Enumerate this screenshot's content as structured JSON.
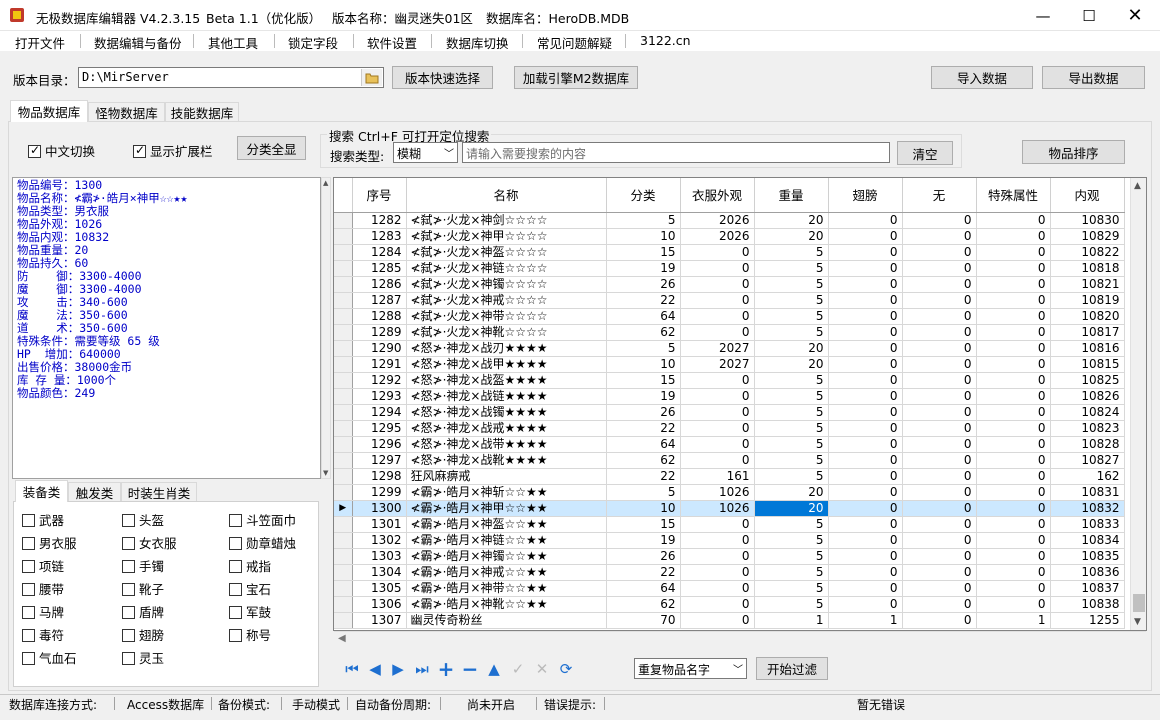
{
  "title": {
    "app": "无极数据库编辑器 V4.2.3.15",
    "beta": "Beta 1.1（优化版）",
    "version_name": "版本名称：幽灵迷失01区",
    "db_name": "数据库名：HeroDB.MDB"
  },
  "menu": [
    "打开文件",
    "数据编辑与备份",
    "其他工具",
    "锁定字段",
    "软件设置",
    "数据库切换",
    "常见问题解疑",
    "3122.cn"
  ],
  "toolbar": {
    "dir_label": "版本目录：",
    "dir_value": "D:\\MirServer",
    "quick_select": "版本快速选择",
    "load_engine": "加载引擎M2数据库",
    "import": "导入数据",
    "export": "导出数据"
  },
  "tabs": [
    "物品数据库",
    "怪物数据库",
    "技能数据库"
  ],
  "options": {
    "chinese_switch": "中文切换",
    "show_extension": "显示扩展栏",
    "show_all_categories": "分类全显"
  },
  "search": {
    "group_title": "搜索   Ctrl+F 可打开定位搜索",
    "type_label": "搜索类型:",
    "type_value": "模糊",
    "placeholder": "请输入需要搜索的内容",
    "clear": "清空",
    "sort": "物品排序"
  },
  "info_lines": [
    "物品编号：1300",
    "物品名称：≮霸≯·皓月×神甲☆☆★★",
    "物品类型：男衣服",
    "物品外观：1026",
    "物品内观：10832",
    "物品重量：20",
    "物品持久：60",
    "防    御：3300-4000",
    "魔    御：3300-4000",
    "攻    击：340-600",
    "魔    法：350-600",
    "道    术：350-600",
    "特殊条件：需要等级 65 级",
    "HP  增加：640000",
    "出售价格：38000金币",
    "库 存 量：1000个",
    "物品颜色：249"
  ],
  "category_tabs": [
    "装备类",
    "触发类",
    "时装生肖类"
  ],
  "categories": [
    [
      "武器",
      "头盔",
      "斗笠面巾"
    ],
    [
      "男衣服",
      "女衣服",
      "勋章蜡烛"
    ],
    [
      "项链",
      "手镯",
      "戒指"
    ],
    [
      "腰带",
      "靴子",
      "宝石"
    ],
    [
      "马牌",
      "盾牌",
      "军鼓"
    ],
    [
      "毒符",
      "翅膀",
      "称号"
    ],
    [
      "气血石",
      "灵玉",
      ""
    ]
  ],
  "grid": {
    "columns": [
      "序号",
      "名称",
      "分类",
      "衣服外观",
      "重量",
      "翅膀",
      "无",
      "特殊属性",
      "内观"
    ],
    "selected_index": 18,
    "rows": [
      [
        "1282",
        "≮弑≯·火龙×神剑☆☆☆☆",
        "5",
        "2026",
        "20",
        "0",
        "0",
        "0",
        "10830"
      ],
      [
        "1283",
        "≮弑≯·火龙×神甲☆☆☆☆",
        "10",
        "2026",
        "20",
        "0",
        "0",
        "0",
        "10829"
      ],
      [
        "1284",
        "≮弑≯·火龙×神盔☆☆☆☆",
        "15",
        "0",
        "5",
        "0",
        "0",
        "0",
        "10822"
      ],
      [
        "1285",
        "≮弑≯·火龙×神链☆☆☆☆",
        "19",
        "0",
        "5",
        "0",
        "0",
        "0",
        "10818"
      ],
      [
        "1286",
        "≮弑≯·火龙×神镯☆☆☆☆",
        "26",
        "0",
        "5",
        "0",
        "0",
        "0",
        "10821"
      ],
      [
        "1287",
        "≮弑≯·火龙×神戒☆☆☆☆",
        "22",
        "0",
        "5",
        "0",
        "0",
        "0",
        "10819"
      ],
      [
        "1288",
        "≮弑≯·火龙×神带☆☆☆☆",
        "64",
        "0",
        "5",
        "0",
        "0",
        "0",
        "10820"
      ],
      [
        "1289",
        "≮弑≯·火龙×神靴☆☆☆☆",
        "62",
        "0",
        "5",
        "0",
        "0",
        "0",
        "10817"
      ],
      [
        "1290",
        "≮怒≯·神龙×战刃★★★★",
        "5",
        "2027",
        "20",
        "0",
        "0",
        "0",
        "10816"
      ],
      [
        "1291",
        "≮怒≯·神龙×战甲★★★★",
        "10",
        "2027",
        "20",
        "0",
        "0",
        "0",
        "10815"
      ],
      [
        "1292",
        "≮怒≯·神龙×战盔★★★★",
        "15",
        "0",
        "5",
        "0",
        "0",
        "0",
        "10825"
      ],
      [
        "1293",
        "≮怒≯·神龙×战链★★★★",
        "19",
        "0",
        "5",
        "0",
        "0",
        "0",
        "10826"
      ],
      [
        "1294",
        "≮怒≯·神龙×战镯★★★★",
        "26",
        "0",
        "5",
        "0",
        "0",
        "0",
        "10824"
      ],
      [
        "1295",
        "≮怒≯·神龙×战戒★★★★",
        "22",
        "0",
        "5",
        "0",
        "0",
        "0",
        "10823"
      ],
      [
        "1296",
        "≮怒≯·神龙×战带★★★★",
        "64",
        "0",
        "5",
        "0",
        "0",
        "0",
        "10828"
      ],
      [
        "1297",
        "≮怒≯·神龙×战靴★★★★",
        "62",
        "0",
        "5",
        "0",
        "0",
        "0",
        "10827"
      ],
      [
        "1298",
        "狂风麻痹戒",
        "22",
        "161",
        "5",
        "0",
        "0",
        "0",
        "162"
      ],
      [
        "1299",
        "≮霸≯·皓月×神斩☆☆★★",
        "5",
        "1026",
        "20",
        "0",
        "0",
        "0",
        "10831"
      ],
      [
        "1300",
        "≮霸≯·皓月×神甲☆☆★★",
        "10",
        "1026",
        "20",
        "0",
        "0",
        "0",
        "10832"
      ],
      [
        "1301",
        "≮霸≯·皓月×神盔☆☆★★",
        "15",
        "0",
        "5",
        "0",
        "0",
        "0",
        "10833"
      ],
      [
        "1302",
        "≮霸≯·皓月×神链☆☆★★",
        "19",
        "0",
        "5",
        "0",
        "0",
        "0",
        "10834"
      ],
      [
        "1303",
        "≮霸≯·皓月×神镯☆☆★★",
        "26",
        "0",
        "5",
        "0",
        "0",
        "0",
        "10835"
      ],
      [
        "1304",
        "≮霸≯·皓月×神戒☆☆★★",
        "22",
        "0",
        "5",
        "0",
        "0",
        "0",
        "10836"
      ],
      [
        "1305",
        "≮霸≯·皓月×神带☆☆★★",
        "64",
        "0",
        "5",
        "0",
        "0",
        "0",
        "10837"
      ],
      [
        "1306",
        "≮霸≯·皓月×神靴☆☆★★",
        "62",
        "0",
        "5",
        "0",
        "0",
        "0",
        "10838"
      ],
      [
        "1307",
        "幽灵传奇粉丝",
        "70",
        "0",
        "1",
        "1",
        "0",
        "1",
        "1255"
      ]
    ]
  },
  "bottom": {
    "filter_select": "重复物品名字",
    "start_filter": "开始过滤"
  },
  "status": {
    "conn_label": "数据库连接方式:",
    "conn_value": "Access数据库",
    "backup_label": "备份模式:",
    "backup_value": "手动模式",
    "auto_label": "自动备份周期:",
    "auto_value": "尚未开启",
    "err_label": "错误提示:",
    "err_value": "暂无错误"
  },
  "colors": {
    "info_text": "#0000c8",
    "selection": "#cce8ff",
    "focus_cell": "#0078d7",
    "nav_icons": "#1e6fd0"
  }
}
